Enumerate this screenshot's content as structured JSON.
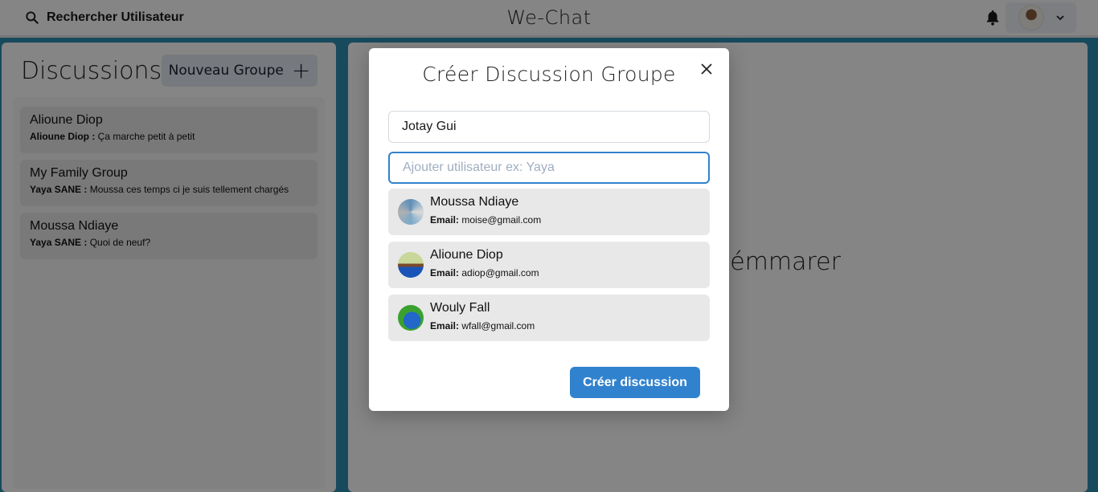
{
  "topbar": {
    "search_label": "Rechercher Utilisateur",
    "app_title": "We-Chat",
    "icons": {
      "search": "search-icon",
      "bell": "bell-icon",
      "chevron": "chevron-down-icon"
    }
  },
  "sidebar": {
    "title": "Discussions",
    "new_group_label": "Nouveau Groupe",
    "chats": [
      {
        "name": "Alioune Diop",
        "sender": "Alioune Diop :",
        "message": "Ça marche petit à petit"
      },
      {
        "name": "My Family Group",
        "sender": "Yaya SANE :",
        "message": "Moussa ces temps ci je suis tellement chargés"
      },
      {
        "name": "Moussa Ndiaye",
        "sender": "Yaya SANE :",
        "message": "Quoi de neuf?"
      }
    ]
  },
  "main": {
    "placeholder": "sion pour démmarer"
  },
  "modal": {
    "title": "Créer Discussion Groupe",
    "group_name_value": "Jotay Gui",
    "user_search_placeholder": "Ajouter utilisateur ex: Yaya",
    "email_label": "Email:",
    "users": [
      {
        "name": "Moussa Ndiaye",
        "email": "moise@gmail.com"
      },
      {
        "name": "Alioune Diop",
        "email": "adiop@gmail.com"
      },
      {
        "name": "Wouly Fall",
        "email": "wfall@gmail.com"
      }
    ],
    "create_label": "Créer discussion"
  },
  "colors": {
    "accent": "#3182ce",
    "page_background": "#2f8fb3",
    "item_background": "#e8e8e8"
  }
}
